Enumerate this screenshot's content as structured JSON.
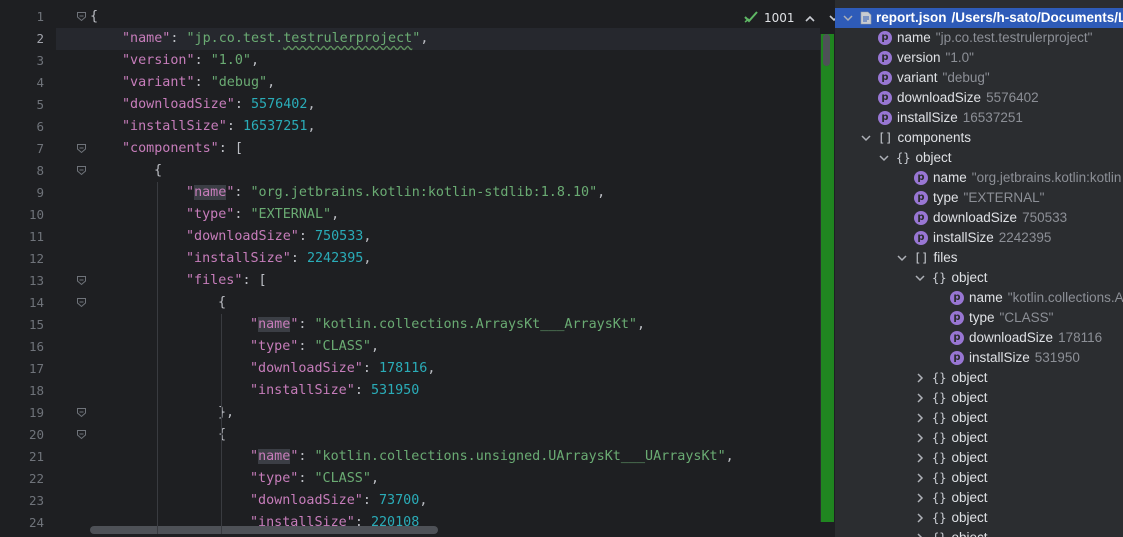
{
  "editor": {
    "current_line": 2,
    "inspection": {
      "count": "1001"
    },
    "lines": [
      {
        "num": "1",
        "indent": 0,
        "tokens": [
          {
            "t": "p",
            "v": "{"
          }
        ]
      },
      {
        "num": "2",
        "indent": 1,
        "tokens": [
          {
            "t": "k",
            "v": "\"name\""
          },
          {
            "t": "p",
            "v": ": "
          },
          {
            "t": "s",
            "v": "\"jp.co.test."
          },
          {
            "t": "s typo",
            "v": "testrulerproject"
          },
          {
            "t": "s",
            "v": "\""
          },
          {
            "t": "p",
            "v": ","
          }
        ]
      },
      {
        "num": "3",
        "indent": 1,
        "tokens": [
          {
            "t": "k",
            "v": "\"version\""
          },
          {
            "t": "p",
            "v": ": "
          },
          {
            "t": "s",
            "v": "\"1.0\""
          },
          {
            "t": "p",
            "v": ","
          }
        ]
      },
      {
        "num": "4",
        "indent": 1,
        "tokens": [
          {
            "t": "k",
            "v": "\"variant\""
          },
          {
            "t": "p",
            "v": ": "
          },
          {
            "t": "s",
            "v": "\"debug\""
          },
          {
            "t": "p",
            "v": ","
          }
        ]
      },
      {
        "num": "5",
        "indent": 1,
        "tokens": [
          {
            "t": "k",
            "v": "\"downloadSize\""
          },
          {
            "t": "p",
            "v": ": "
          },
          {
            "t": "n",
            "v": "5576402"
          },
          {
            "t": "p",
            "v": ","
          }
        ]
      },
      {
        "num": "6",
        "indent": 1,
        "tokens": [
          {
            "t": "k",
            "v": "\"installSize\""
          },
          {
            "t": "p",
            "v": ": "
          },
          {
            "t": "n",
            "v": "16537251"
          },
          {
            "t": "p",
            "v": ","
          }
        ]
      },
      {
        "num": "7",
        "indent": 1,
        "tokens": [
          {
            "t": "k",
            "v": "\"components\""
          },
          {
            "t": "p",
            "v": ": ["
          }
        ]
      },
      {
        "num": "8",
        "indent": 2,
        "tokens": [
          {
            "t": "p",
            "v": "{"
          }
        ]
      },
      {
        "num": "9",
        "indent": 3,
        "tokens": [
          {
            "t": "k",
            "v": "\""
          },
          {
            "t": "k hl",
            "v": "name"
          },
          {
            "t": "k",
            "v": "\""
          },
          {
            "t": "p",
            "v": ": "
          },
          {
            "t": "s",
            "v": "\"org.jetbrains.kotlin:kotlin-stdlib:1.8.10\""
          },
          {
            "t": "p",
            "v": ","
          }
        ]
      },
      {
        "num": "10",
        "indent": 3,
        "tokens": [
          {
            "t": "k",
            "v": "\"type\""
          },
          {
            "t": "p",
            "v": ": "
          },
          {
            "t": "s",
            "v": "\"EXTERNAL\""
          },
          {
            "t": "p",
            "v": ","
          }
        ]
      },
      {
        "num": "11",
        "indent": 3,
        "tokens": [
          {
            "t": "k",
            "v": "\"downloadSize\""
          },
          {
            "t": "p",
            "v": ": "
          },
          {
            "t": "n",
            "v": "750533"
          },
          {
            "t": "p",
            "v": ","
          }
        ]
      },
      {
        "num": "12",
        "indent": 3,
        "tokens": [
          {
            "t": "k",
            "v": "\"installSize\""
          },
          {
            "t": "p",
            "v": ": "
          },
          {
            "t": "n",
            "v": "2242395"
          },
          {
            "t": "p",
            "v": ","
          }
        ]
      },
      {
        "num": "13",
        "indent": 3,
        "tokens": [
          {
            "t": "k",
            "v": "\"files\""
          },
          {
            "t": "p",
            "v": ": ["
          }
        ]
      },
      {
        "num": "14",
        "indent": 4,
        "tokens": [
          {
            "t": "p",
            "v": "{"
          }
        ]
      },
      {
        "num": "15",
        "indent": 5,
        "tokens": [
          {
            "t": "k",
            "v": "\""
          },
          {
            "t": "k hl",
            "v": "name"
          },
          {
            "t": "k",
            "v": "\""
          },
          {
            "t": "p",
            "v": ": "
          },
          {
            "t": "s",
            "v": "\"kotlin.collections.ArraysKt___ArraysKt\""
          },
          {
            "t": "p",
            "v": ","
          }
        ]
      },
      {
        "num": "16",
        "indent": 5,
        "tokens": [
          {
            "t": "k",
            "v": "\"type\""
          },
          {
            "t": "p",
            "v": ": "
          },
          {
            "t": "s",
            "v": "\"CLASS\""
          },
          {
            "t": "p",
            "v": ","
          }
        ]
      },
      {
        "num": "17",
        "indent": 5,
        "tokens": [
          {
            "t": "k",
            "v": "\"downloadSize\""
          },
          {
            "t": "p",
            "v": ": "
          },
          {
            "t": "n",
            "v": "178116"
          },
          {
            "t": "p",
            "v": ","
          }
        ]
      },
      {
        "num": "18",
        "indent": 5,
        "tokens": [
          {
            "t": "k",
            "v": "\"installSize\""
          },
          {
            "t": "p",
            "v": ": "
          },
          {
            "t": "n",
            "v": "531950"
          }
        ]
      },
      {
        "num": "19",
        "indent": 4,
        "tokens": [
          {
            "t": "p",
            "v": "},"
          }
        ]
      },
      {
        "num": "20",
        "indent": 4,
        "tokens": [
          {
            "t": "p",
            "v": "{"
          }
        ]
      },
      {
        "num": "21",
        "indent": 5,
        "tokens": [
          {
            "t": "k",
            "v": "\""
          },
          {
            "t": "k hl",
            "v": "name"
          },
          {
            "t": "k",
            "v": "\""
          },
          {
            "t": "p",
            "v": ": "
          },
          {
            "t": "s",
            "v": "\"kotlin.collections.unsigned.UArraysKt___UArraysKt\""
          },
          {
            "t": "p",
            "v": ","
          }
        ]
      },
      {
        "num": "22",
        "indent": 5,
        "tokens": [
          {
            "t": "k",
            "v": "\"type\""
          },
          {
            "t": "p",
            "v": ": "
          },
          {
            "t": "s",
            "v": "\"CLASS\""
          },
          {
            "t": "p",
            "v": ","
          }
        ]
      },
      {
        "num": "23",
        "indent": 5,
        "tokens": [
          {
            "t": "k",
            "v": "\"downloadSize\""
          },
          {
            "t": "p",
            "v": ": "
          },
          {
            "t": "n",
            "v": "73700"
          },
          {
            "t": "p",
            "v": ","
          }
        ]
      },
      {
        "num": "24",
        "indent": 5,
        "tokens": [
          {
            "t": "k",
            "v": "\"installSize\""
          },
          {
            "t": "p",
            "v": ": "
          },
          {
            "t": "n",
            "v": "220108"
          }
        ]
      }
    ],
    "fold_lines": [
      1,
      7,
      8,
      13,
      14,
      19,
      20
    ]
  },
  "structure": {
    "rows": [
      {
        "level": 0,
        "arrow": "down",
        "kind": "file",
        "label": "report.json",
        "value": "/Users/h-sato/Documents/Lo",
        "selected": true
      },
      {
        "level": 1,
        "arrow": "",
        "kind": "prop",
        "label": "name",
        "value": "\"jp.co.test.testrulerproject\""
      },
      {
        "level": 1,
        "arrow": "",
        "kind": "prop",
        "label": "version",
        "value": "\"1.0\""
      },
      {
        "level": 1,
        "arrow": "",
        "kind": "prop",
        "label": "variant",
        "value": "\"debug\""
      },
      {
        "level": 1,
        "arrow": "",
        "kind": "prop",
        "label": "downloadSize",
        "value": "5576402"
      },
      {
        "level": 1,
        "arrow": "",
        "kind": "prop",
        "label": "installSize",
        "value": "16537251"
      },
      {
        "level": 1,
        "arrow": "down",
        "kind": "array",
        "label": "components",
        "value": ""
      },
      {
        "level": 2,
        "arrow": "down",
        "kind": "object",
        "label": "object",
        "value": ""
      },
      {
        "level": 3,
        "arrow": "",
        "kind": "prop",
        "label": "name",
        "value": "\"org.jetbrains.kotlin:kotlin"
      },
      {
        "level": 3,
        "arrow": "",
        "kind": "prop",
        "label": "type",
        "value": "\"EXTERNAL\""
      },
      {
        "level": 3,
        "arrow": "",
        "kind": "prop",
        "label": "downloadSize",
        "value": "750533"
      },
      {
        "level": 3,
        "arrow": "",
        "kind": "prop",
        "label": "installSize",
        "value": "2242395"
      },
      {
        "level": 3,
        "arrow": "down",
        "kind": "array",
        "label": "files",
        "value": ""
      },
      {
        "level": 4,
        "arrow": "down",
        "kind": "object",
        "label": "object",
        "value": ""
      },
      {
        "level": 5,
        "arrow": "",
        "kind": "prop",
        "label": "name",
        "value": "\"kotlin.collections.A"
      },
      {
        "level": 5,
        "arrow": "",
        "kind": "prop",
        "label": "type",
        "value": "\"CLASS\""
      },
      {
        "level": 5,
        "arrow": "",
        "kind": "prop",
        "label": "downloadSize",
        "value": "178116"
      },
      {
        "level": 5,
        "arrow": "",
        "kind": "prop",
        "label": "installSize",
        "value": "531950"
      },
      {
        "level": 4,
        "arrow": "right",
        "kind": "object",
        "label": "object",
        "value": ""
      },
      {
        "level": 4,
        "arrow": "right",
        "kind": "object",
        "label": "object",
        "value": ""
      },
      {
        "level": 4,
        "arrow": "right",
        "kind": "object",
        "label": "object",
        "value": ""
      },
      {
        "level": 4,
        "arrow": "right",
        "kind": "object",
        "label": "object",
        "value": ""
      },
      {
        "level": 4,
        "arrow": "right",
        "kind": "object",
        "label": "object",
        "value": ""
      },
      {
        "level": 4,
        "arrow": "right",
        "kind": "object",
        "label": "object",
        "value": ""
      },
      {
        "level": 4,
        "arrow": "right",
        "kind": "object",
        "label": "object",
        "value": ""
      },
      {
        "level": 4,
        "arrow": "right",
        "kind": "object",
        "label": "object",
        "value": ""
      },
      {
        "level": 4,
        "arrow": "right",
        "kind": "object",
        "label": "object",
        "value": ""
      }
    ]
  },
  "icons": {
    "prop_badge": "p",
    "object_glyph": "{}",
    "array_glyph": "[]",
    "arrow_down": "⌄",
    "arrow_right": "›",
    "inspection_ok": "check-icon",
    "nav_up": "chevron-up-icon",
    "nav_down": "chevron-down-icon"
  },
  "colors": {
    "key": "#c77dbb",
    "string": "#6aab73",
    "number": "#2aacb8",
    "selection": "#2e5bb8",
    "badge": "#9876d3",
    "marker_strip": "#1f8f1f"
  }
}
